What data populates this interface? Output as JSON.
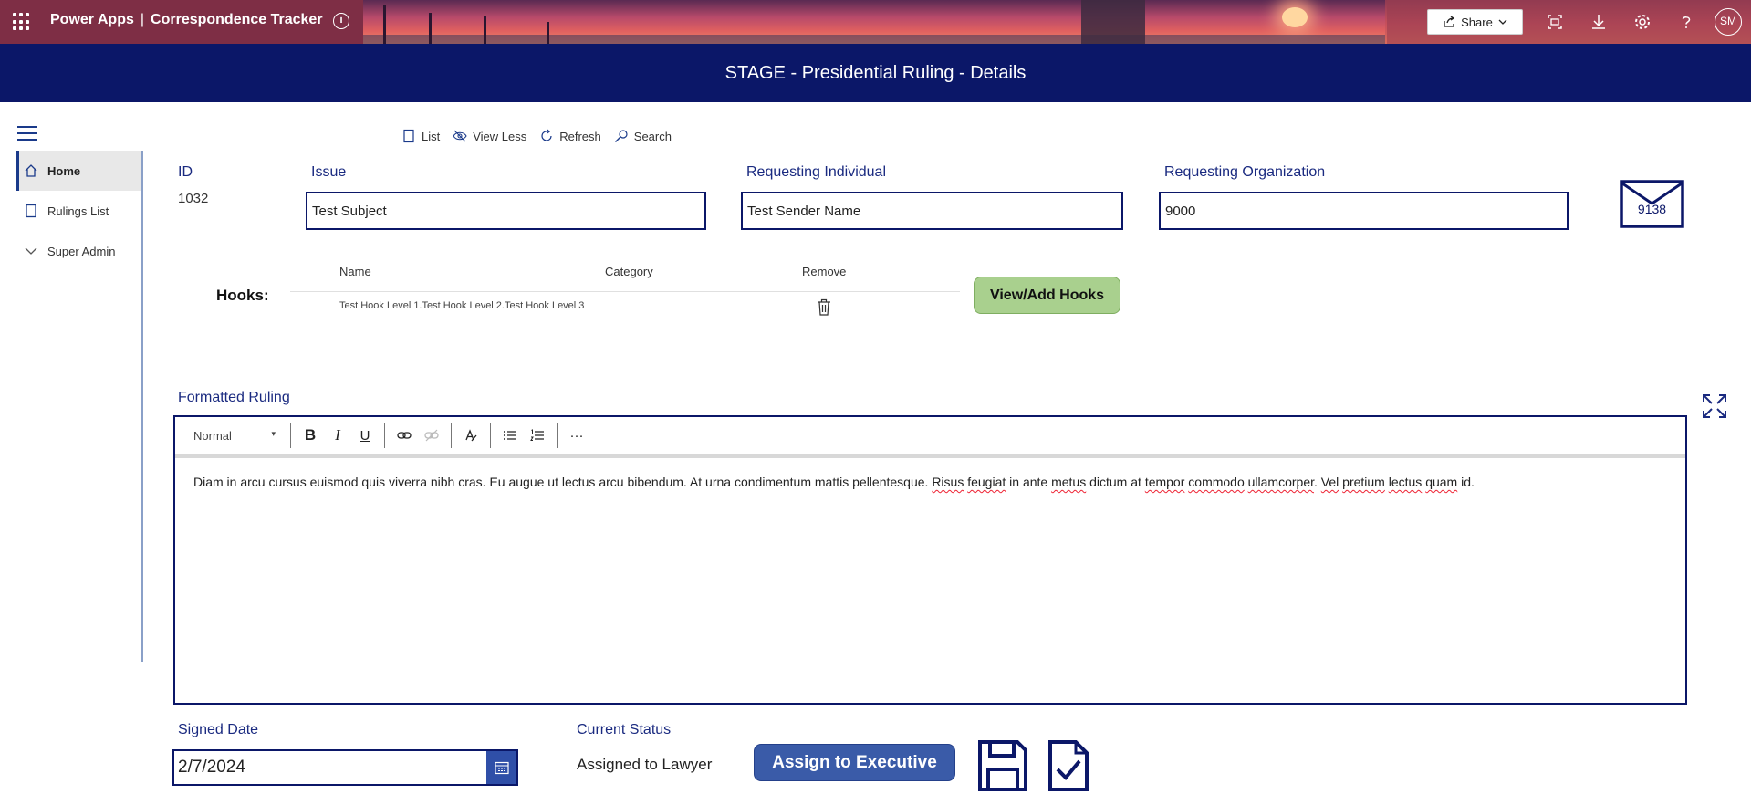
{
  "app": {
    "brand": "Power Apps",
    "separator": "|",
    "name": "Correspondence Tracker",
    "share_label": "Share",
    "avatar_initials": "SM"
  },
  "page": {
    "title": "STAGE - Presidential Ruling - Details"
  },
  "nav": {
    "items": [
      {
        "label": "Home",
        "icon": "home-icon",
        "active": true
      },
      {
        "label": "Rulings List",
        "icon": "document-icon",
        "active": false
      },
      {
        "label": "Super Admin",
        "icon": "chevron-down-icon",
        "active": false
      }
    ]
  },
  "command_bar": {
    "list": "List",
    "view_less": "View Less",
    "refresh": "Refresh",
    "search": "Search"
  },
  "form": {
    "id_label": "ID",
    "id_value": "1032",
    "issue_label": "Issue",
    "issue_value": "Test Subject",
    "requesting_individual_label": "Requesting Individual",
    "requesting_individual_value": "Test Sender Name",
    "requesting_org_label": "Requesting Organization",
    "requesting_org_value": "9000",
    "mail_count": "9138"
  },
  "hooks": {
    "label": "Hooks:",
    "columns": [
      "Name",
      "Category",
      "Remove"
    ],
    "rows": [
      {
        "name": "Test Hook Level 1.Test Hook Level 2.Test Hook Level 3",
        "category": ""
      }
    ],
    "button": "View/Add Hooks"
  },
  "ruling": {
    "label": "Formatted Ruling",
    "format": "Normal",
    "text_plain_1": "Diam in arcu cursus euismod quis viverra nibh cras. Eu augue ut lectus arcu bibendum. At urna condimentum mattis pellentesque. ",
    "w_risus": "Risus",
    "w_feugiat": "feugiat",
    "text_plain_2": " in ante ",
    "w_metus": "metus",
    "text_plain_3": " dictum at ",
    "w_tempor": "tempor",
    "text_plain_4": " ",
    "w_commodo": "commodo",
    "text_plain_5": " ",
    "w_ullamcorper": "ullamcorper",
    "text_plain_6": ". ",
    "w_vel": "Vel",
    "text_plain_7": " ",
    "w_pretium": "pretium",
    "text_plain_8": " ",
    "w_lectus": "lectus",
    "text_plain_9": " ",
    "w_quam": "quam",
    "text_plain_10": " id."
  },
  "bottom": {
    "signed_date_label": "Signed Date",
    "signed_date_value": "2/7/2024",
    "current_status_label": "Current Status",
    "current_status_value": "Assigned to Lawyer",
    "assign_button": "Assign to Executive"
  },
  "colors": {
    "navy": "#0b1768",
    "button_blue": "#3a5ba8",
    "hooks_green": "#a9d08e"
  }
}
